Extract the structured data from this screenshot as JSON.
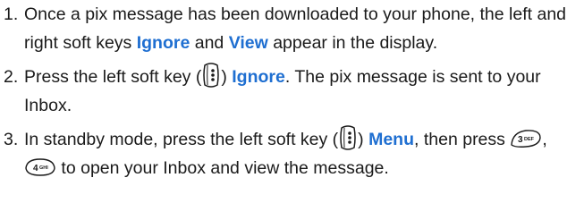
{
  "steps": [
    {
      "number": "1.",
      "t1": "Once a pix message has been downloaded to your phone, the left and right soft keys ",
      "kw1": "Ignore",
      "t2": " and ",
      "kw2": "View",
      "t3": " appear in the display."
    },
    {
      "number": "2.",
      "t1": "Press the left soft key (",
      "t2": ") ",
      "kw1": "Ignore",
      "t3": ". The pix message is sent to your Inbox."
    },
    {
      "number": "3.",
      "t1": "In standby mode, press the left soft key (",
      "t2": ") ",
      "kw1": "Menu",
      "t3": ", then press ",
      "key1_digit": "3",
      "key1_letters": "DEF",
      "sep": ", ",
      "key2_digit": "4",
      "key2_letters": "GHI",
      "t4": " to open your Inbox and view the message."
    }
  ],
  "colors": {
    "keyword": "#1f6fd1",
    "text": "#1a1a1a"
  },
  "icons": {
    "soft_key": "left-soft-key-icon",
    "key_3": "key-3-def-icon",
    "key_4": "key-4-ghi-icon"
  }
}
